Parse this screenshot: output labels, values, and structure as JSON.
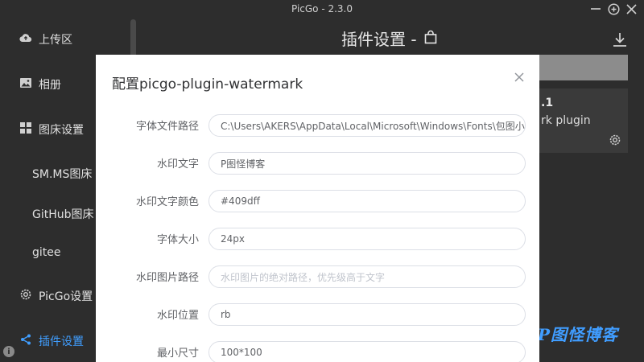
{
  "window": {
    "title": "PicGo - 2.3.0"
  },
  "sidebar": {
    "items": [
      {
        "label": "上传区",
        "icon": "cloud-upload-icon"
      },
      {
        "label": "相册",
        "icon": "image-icon"
      },
      {
        "label": "图床设置",
        "icon": "grid-icon"
      },
      {
        "label": "SM.MS图床"
      },
      {
        "label": "GitHub图床"
      },
      {
        "label": "gitee"
      },
      {
        "label": "PicGo设置",
        "icon": "gear-icon"
      },
      {
        "label": "插件设置",
        "icon": "share-icon"
      }
    ],
    "active_index": 7
  },
  "main": {
    "title": "插件设置 -",
    "plugin_card": {
      "version_fragment": ".1",
      "desc_fragment": "rk plugin"
    },
    "watermark_text": "P图怪博客"
  },
  "dialog": {
    "title": "配置picgo-plugin-watermark",
    "fields": [
      {
        "label": "字体文件路径",
        "value": "C:\\Users\\AKERS\\AppData\\Local\\Microsoft\\Windows\\Fonts\\包图小白",
        "placeholder": ""
      },
      {
        "label": "水印文字",
        "value": "P图怪博客",
        "placeholder": ""
      },
      {
        "label": "水印文字颜色",
        "value": "#409dff",
        "placeholder": ""
      },
      {
        "label": "字体大小",
        "value": "24px",
        "placeholder": ""
      },
      {
        "label": "水印图片路径",
        "value": "",
        "placeholder": "水印图片的绝对路径，优先级高于文字"
      },
      {
        "label": "水印位置",
        "value": "rb",
        "placeholder": ""
      },
      {
        "label": "最小尺寸",
        "value": "100*100",
        "placeholder": ""
      }
    ]
  },
  "colors": {
    "accent": "#409eff",
    "background": "#2d2d2d",
    "dialog": "#ffffff"
  }
}
